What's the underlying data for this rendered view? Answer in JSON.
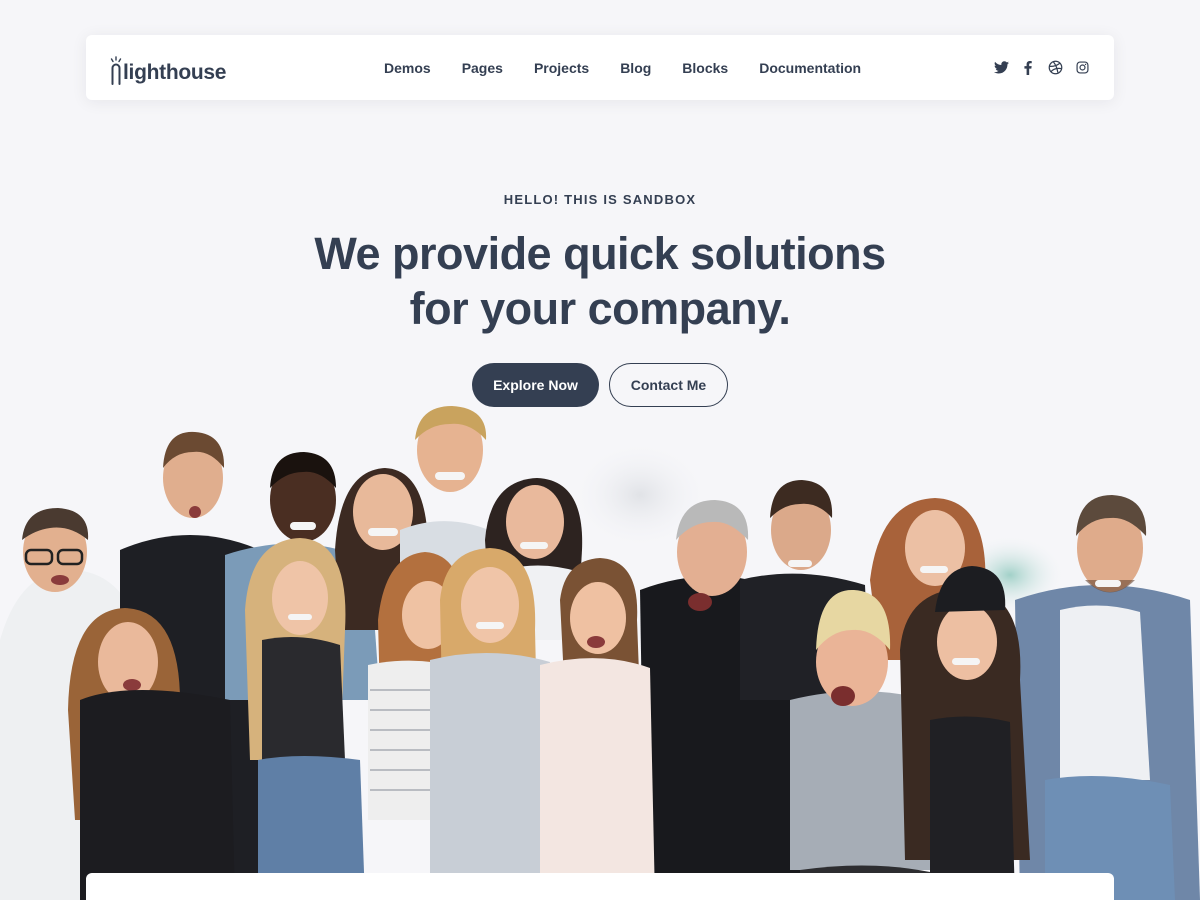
{
  "brand": {
    "logo_text": "lighthouse"
  },
  "nav": {
    "items": [
      {
        "label": "Demos"
      },
      {
        "label": "Pages"
      },
      {
        "label": "Projects"
      },
      {
        "label": "Blog"
      },
      {
        "label": "Blocks"
      },
      {
        "label": "Documentation"
      }
    ],
    "social_icons": [
      "twitter-icon",
      "facebook-icon",
      "dribbble-icon",
      "instagram-icon"
    ]
  },
  "hero": {
    "eyebrow": "HELLO! THIS IS SANDBOX",
    "headline_line1": "We provide quick solutions",
    "headline_line2": "for your company.",
    "primary_button": "Explore Now",
    "secondary_button": "Contact Me"
  },
  "colors": {
    "background": "#f6f6f9",
    "text_dark": "#343f52",
    "button_primary": "#343f52",
    "surface": "#ffffff"
  }
}
